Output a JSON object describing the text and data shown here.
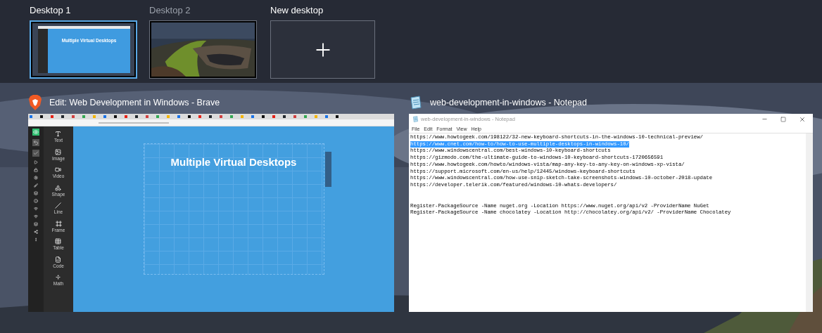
{
  "desktops": [
    {
      "label": "Desktop 1",
      "selected": true,
      "thumbnail_heading": "Multiple Virtual Desktops"
    },
    {
      "label": "Desktop 2",
      "selected": false
    }
  ],
  "new_desktop": {
    "label": "New desktop"
  },
  "windows": [
    {
      "kind": "browser",
      "title": "Edit: Web Development in Windows - Brave",
      "heading": "Multiple Virtual Desktops",
      "tools": [
        "Text",
        "Image",
        "Video",
        "Shape",
        "Line",
        "Frame",
        "Table",
        "Code",
        "Math"
      ]
    },
    {
      "kind": "notepad",
      "title": "web-development-in-windows - Notepad",
      "inner_title": "web-development-in-windows - Notepad",
      "menu": [
        "File",
        "Edit",
        "Format",
        "View",
        "Help"
      ],
      "paragraphs": [
        [
          {
            "text": "https://www.howtogeek.com/198122/32-new-keyboard-shortcuts-in-the-windows-10-technical-preview/",
            "selected": false
          },
          {
            "text": "https://www.cnet.com/how-to/how-to-use-multiple-desktops-in-windows-10/",
            "selected": true
          },
          {
            "text": "https://www.windowscentral.com/best-windows-10-keyboard-shortcuts",
            "selected": false
          },
          {
            "text": "https://gizmodo.com/the-ultimate-guide-to-windows-10-keyboard-shortcuts-1720656591",
            "selected": false
          },
          {
            "text": "https://www.howtogeek.com/howto/windows-vista/map-any-key-to-any-key-on-windows-xp-vista/",
            "selected": false
          },
          {
            "text": "https://support.microsoft.com/en-us/help/12445/windows-keyboard-shortcuts",
            "selected": false
          },
          {
            "text": "https://www.windowscentral.com/how-use-snip-sketch-take-screenshots-windows-10-october-2018-update",
            "selected": false
          },
          {
            "text": "https://developer.telerik.com/featured/windows-10-whats-developers/",
            "selected": false
          }
        ],
        [
          {
            "text": "Register-PackageSource -Name nuget.org -Location https://www.nuget.org/api/v2 -ProviderName NuGet",
            "selected": false
          },
          {
            "text": "Register-PackageSource -Name chocolatey -Location http://chocolatey.org/api/v2/ -ProviderName Chocolatey",
            "selected": false
          }
        ]
      ]
    }
  ]
}
